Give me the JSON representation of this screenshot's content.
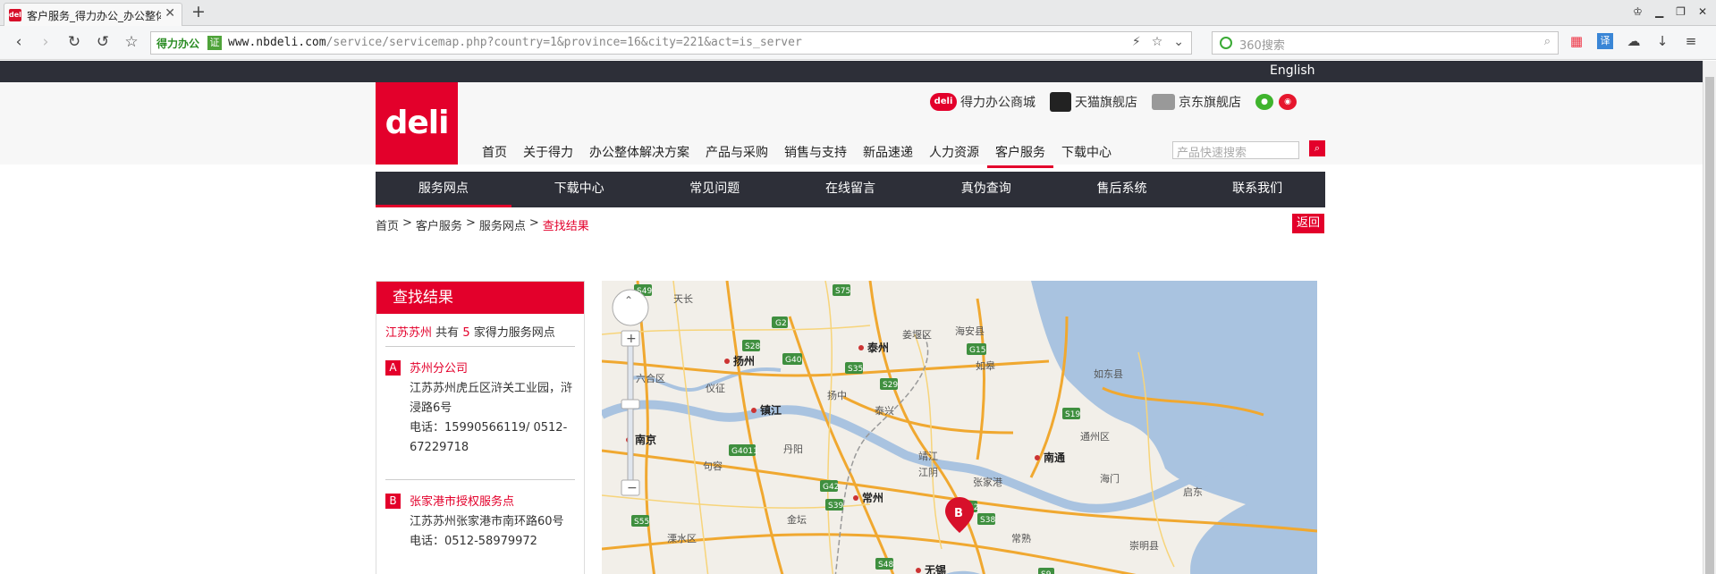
{
  "browser": {
    "tab_title": "客户服务_得力办公_办公整体",
    "tab_favicon": "deli",
    "new_tab": "+",
    "site_identity": "得力办公",
    "security_badge": "证",
    "url_host": "www.nbdeli.com",
    "url_path": "/service/servicemap.php?country=1&province=16&city=221&act=is_server",
    "search_placeholder": "360搜索"
  },
  "page": {
    "language_link": "English",
    "logo_text": "deli",
    "shops": [
      {
        "icon": "deli-mall-icon",
        "badge": "deli",
        "label": "得力办公商城"
      },
      {
        "icon": "tmall-icon",
        "badge": "",
        "label": "天猫旗舰店"
      },
      {
        "icon": "jd-icon",
        "badge": "",
        "label": "京东旗舰店"
      }
    ],
    "main_nav": [
      "首页",
      "关于得力",
      "办公整体解决方案",
      "产品与采购",
      "销售与支持",
      "新品速递",
      "人力资源",
      "客户服务",
      "下载中心"
    ],
    "main_nav_active": "客户服务",
    "product_search_placeholder": "产品快速搜索",
    "sub_nav": [
      "服务网点",
      "下载中心",
      "常见问题",
      "在线留言",
      "真伪查询",
      "售后系统",
      "联系我们"
    ],
    "sub_nav_active": "服务网点",
    "breadcrumb": [
      "首页",
      ">",
      "客户服务",
      ">",
      "服务网点",
      ">",
      "查找结果"
    ],
    "back_button": "返回",
    "result": {
      "title": "查找结果",
      "region": "江苏苏州",
      "count_prefix": "共有",
      "count": "5",
      "count_suffix": "家得力服务网点",
      "entries": [
        {
          "marker": "A",
          "name": "苏州分公司",
          "address": "江苏苏州虎丘区浒关工业园，浒浸路6号",
          "phone": "电话：15990566119/ 0512-67229718"
        },
        {
          "marker": "B",
          "name": "张家港市授权服务点",
          "address": "江苏苏州张家港市南环路60号",
          "phone": "电话：0512-58979972"
        }
      ]
    },
    "map": {
      "cities": [
        "扬州",
        "泰州",
        "镇江",
        "南京",
        "常州",
        "南通",
        "无锡"
      ],
      "towns": [
        "天长",
        "姜堰区",
        "海安县",
        "如皋",
        "如东县",
        "六合区",
        "仪征",
        "扬中",
        "泰兴",
        "通州区",
        "句容",
        "丹阳",
        "靖江",
        "江阴",
        "张家港",
        "海门",
        "启东",
        "金坛",
        "溧水区",
        "常熟",
        "崇明县"
      ],
      "roads": [
        "S49",
        "G2",
        "S75",
        "S28",
        "G40",
        "S35",
        "S29",
        "G15",
        "S19",
        "G4011",
        "G42",
        "S39",
        "S38",
        "S55",
        "S48",
        "G42",
        "S9"
      ],
      "marker": "B"
    }
  }
}
